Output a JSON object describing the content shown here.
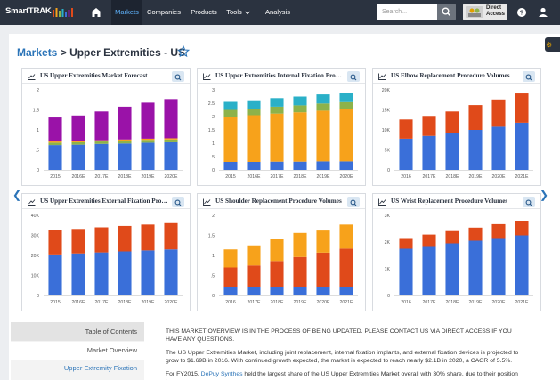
{
  "nav": {
    "brand": "SmartTRAK",
    "items": [
      {
        "label": "Markets",
        "active": true
      },
      {
        "label": "Companies",
        "active": false
      },
      {
        "label": "Products",
        "active": false
      },
      {
        "label": "Tools",
        "active": false
      },
      {
        "label": "Analysis",
        "active": false
      }
    ],
    "search_placeholder": "Search...",
    "direct_access_line1": "Direct",
    "direct_access_line2": "Access"
  },
  "breadcrumb": {
    "root": "Markets",
    "separator": ">",
    "title": "Upper Extremities - US"
  },
  "colors": {
    "nav_bg": "#2b3340",
    "link_blue": "#2b74b8",
    "bar_blue": "#3a6fd9",
    "bar_orange": "#f7a21b",
    "bar_red": "#e04a1a",
    "bar_purple": "#9a12a8",
    "bar_green": "#8db24a",
    "bar_teal": "#2ab0c8"
  },
  "toc": {
    "header": "Table of Contents",
    "items": [
      "Market Overview",
      "Upper Extremity Fixation"
    ]
  },
  "content": {
    "notice": "THIS MARKET OVERVIEW IS IN THE PROCESS OF BEING UPDATED. PLEASE CONTACT US VIA DIRECT ACCESS IF YOU HAVE ANY QUESTIONS.",
    "para1": "The US Upper Extremities Market, including joint replacement, internal fixation implants, and external fixation devices is projected to grow to $1.69B in 2016. With continued growth expected, the market is expected to reach nearly $2.1B in 2020, a CAGR of 5.5%.",
    "para2_prefix": "For FY2015, ",
    "para2_link": "DePuy Synthes",
    "para2_suffix": " held the largest share of the US Upper Extremities Market overall with 30% share, due to their position in"
  },
  "chart_data": [
    {
      "type": "bar",
      "stacked": true,
      "title": "US Upper Extremities Market Forecast",
      "categories": [
        "2015",
        "2016E",
        "2017E",
        "2018E",
        "2019E",
        "2020E"
      ],
      "yticks": [
        "0",
        ".5",
        "1",
        "1.5",
        "2"
      ],
      "ylim": [
        0,
        2
      ],
      "series": [
        {
          "color": "#3a6fd9",
          "values": [
            0.62,
            0.63,
            0.65,
            0.66,
            0.68,
            0.69
          ]
        },
        {
          "color": "#8db24a",
          "values": [
            0.06,
            0.06,
            0.06,
            0.07,
            0.07,
            0.07
          ]
        },
        {
          "color": "#f7a21b",
          "values": [
            0.03,
            0.03,
            0.03,
            0.03,
            0.03,
            0.03
          ]
        },
        {
          "color": "#9a12a8",
          "values": [
            0.6,
            0.64,
            0.72,
            0.82,
            0.9,
            0.98
          ]
        }
      ]
    },
    {
      "type": "bar",
      "stacked": true,
      "title": "US Upper Extremities Internal Fixation Procedure Volumes",
      "categories": [
        "2015",
        "2016E",
        "2017E",
        "2018E",
        "2019E",
        "2020E"
      ],
      "yticks": [
        "0",
        ".5",
        "1",
        "1.5",
        "2",
        "2.5",
        "3"
      ],
      "ylim": [
        0,
        3
      ],
      "series": [
        {
          "color": "#3a6fd9",
          "values": [
            0.3,
            0.3,
            0.31,
            0.31,
            0.32,
            0.32
          ]
        },
        {
          "color": "#f7a21b",
          "values": [
            1.7,
            1.75,
            1.8,
            1.85,
            1.9,
            1.95
          ]
        },
        {
          "color": "#8db24a",
          "values": [
            0.25,
            0.25,
            0.26,
            0.26,
            0.27,
            0.27
          ]
        },
        {
          "color": "#2ab0c8",
          "values": [
            0.3,
            0.31,
            0.32,
            0.33,
            0.34,
            0.35
          ]
        }
      ]
    },
    {
      "type": "bar",
      "stacked": true,
      "title": "US Elbow Replacement Procedure Volumes",
      "categories": [
        "2016",
        "2017E",
        "2018E",
        "2019E",
        "2020E",
        "2021E"
      ],
      "yticks": [
        "0",
        "5K",
        "10K",
        "15K",
        "20K"
      ],
      "ylim": [
        0,
        20000
      ],
      "series": [
        {
          "color": "#3a6fd9",
          "values": [
            7800,
            8500,
            9200,
            10000,
            10800,
            11800
          ]
        },
        {
          "color": "#e04a1a",
          "values": [
            4800,
            5000,
            5400,
            6200,
            6800,
            7300
          ]
        }
      ]
    },
    {
      "type": "bar",
      "stacked": true,
      "title": "US Upper Extremities External Fixation Procedure Volumes",
      "categories": [
        "2015",
        "2016E",
        "2017E",
        "2018E",
        "2019E",
        "2020E"
      ],
      "yticks": [
        "0",
        "10K",
        "20K",
        "30K",
        "40K"
      ],
      "ylim": [
        0,
        40000
      ],
      "series": [
        {
          "color": "#3a6fd9",
          "values": [
            20500,
            21000,
            21500,
            22000,
            22500,
            23000
          ]
        },
        {
          "color": "#e04a1a",
          "values": [
            12000,
            12200,
            12500,
            12700,
            12900,
            13100
          ]
        }
      ]
    },
    {
      "type": "bar",
      "stacked": true,
      "title": "US Shoulder Replacement Procedure Volumes",
      "categories": [
        "2016",
        "2017E",
        "2018E",
        "2019E",
        "2020E",
        "2021E"
      ],
      "yticks": [
        "0",
        ".5",
        "1",
        "1.5",
        "2"
      ],
      "ylim": [
        0,
        2
      ],
      "series": [
        {
          "color": "#3a6fd9",
          "values": [
            0.2,
            0.2,
            0.21,
            0.21,
            0.22,
            0.22
          ]
        },
        {
          "color": "#e04a1a",
          "values": [
            0.5,
            0.55,
            0.65,
            0.75,
            0.85,
            0.95
          ]
        },
        {
          "color": "#f7a21b",
          "values": [
            0.45,
            0.5,
            0.55,
            0.6,
            0.55,
            0.6
          ]
        }
      ]
    },
    {
      "type": "bar",
      "stacked": true,
      "title": "US Wrist Replacement Procedure Volumes",
      "categories": [
        "2016",
        "2017E",
        "2018E",
        "2019E",
        "2020E",
        "2021E"
      ],
      "yticks": [
        "0",
        "1K",
        "2K",
        "3K"
      ],
      "ylim": [
        0,
        3000
      ],
      "series": [
        {
          "color": "#3a6fd9",
          "values": [
            1750,
            1850,
            1950,
            2050,
            2150,
            2250
          ]
        },
        {
          "color": "#e04a1a",
          "values": [
            400,
            430,
            460,
            490,
            520,
            550
          ]
        }
      ]
    }
  ]
}
